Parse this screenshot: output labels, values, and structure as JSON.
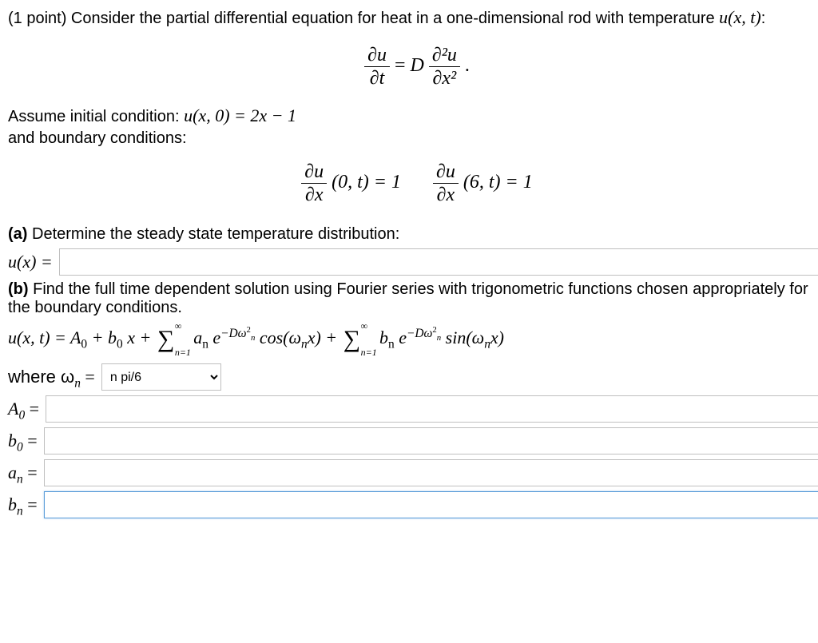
{
  "points": "(1 point)",
  "intro1": " Consider the partial differential equation for heat in a one-dimensional rod with temperature ",
  "u_xt": "u(x, t)",
  "colon": ":",
  "main_pde": {
    "lhs_num": "∂u",
    "lhs_den": "∂t",
    "eq": " = ",
    "D": "D",
    "rhs_num": "∂²u",
    "rhs_den": "∂x²",
    "dot": "."
  },
  "assume": "Assume initial condition: ",
  "ic": "u(x, 0) = 2x − 1",
  "and_bc": "and boundary conditions:",
  "bc": {
    "frac_num": "∂u",
    "frac_den": "∂x",
    "left": "(0, t) = 1",
    "right": "(6, t) = 1"
  },
  "part_a_title": "(a)",
  "part_a_text": " Determine the steady state temperature distribution:",
  "u_x_eq": "u(x) = ",
  "part_b_title": "(b)",
  "part_b_text": " Find the full time dependent solution using Fourier series with trigonometric functions chosen appropriately for the boundary conditions.",
  "series": {
    "prefix": "u(x, t) = A",
    "sub0": "0",
    "plus_b0x": " + b",
    "x": "x + ",
    "sum_lo": "n=1",
    "sum_hi": "∞",
    "a_n": " a",
    "subn": "n",
    "e": "e",
    "exp": "−Dω",
    "cos": " cos(ω",
    "x_close": "x) + ",
    "b_n": " b",
    "sin": " sin(ω",
    "x_close2": "x)"
  },
  "where_label": "where ω",
  "where_sub": "n",
  "where_eq": " = ",
  "omega_options": [
    "n pi/6"
  ],
  "omega_value": "n pi/6",
  "labels": {
    "A0": "A",
    "b0": "b",
    "an": "a",
    "bn": "b",
    "sub0": "0",
    "subn": "n",
    "eq": " = "
  }
}
